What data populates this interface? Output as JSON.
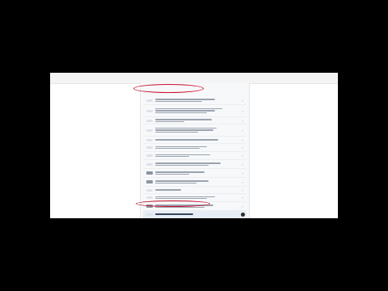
{
  "sidebar": {
    "header": "",
    "items": [
      {
        "icon": "doc-icon",
        "label": "",
        "count": ""
      },
      {
        "icon": "doc-icon",
        "label": "",
        "count": ""
      },
      {
        "icon": "doc-icon",
        "label": "",
        "count": ""
      },
      {
        "icon": "doc-icon",
        "label": "",
        "count": ""
      },
      {
        "icon": "doc-icon",
        "label": "",
        "count": ""
      },
      {
        "icon": "doc-icon",
        "label": "",
        "count": ""
      },
      {
        "icon": "doc-icon",
        "label": "",
        "count": ""
      },
      {
        "icon": "doc-icon",
        "label": "",
        "count": ""
      },
      {
        "icon": "doc-icon",
        "label": "",
        "count": ""
      },
      {
        "icon": "doc-icon",
        "label": "",
        "count": ""
      },
      {
        "icon": "doc-icon",
        "label": "",
        "count": ""
      },
      {
        "icon": "doc-icon",
        "label": "",
        "count": ""
      },
      {
        "icon": "doc-icon",
        "label": "",
        "count": ""
      },
      {
        "icon": "doc-icon",
        "label": "",
        "count": ""
      },
      {
        "icon": "doc-icon",
        "label": "",
        "count": ""
      },
      {
        "icon": "doc-icon",
        "label": "",
        "count": ""
      },
      {
        "icon": "doc-icon",
        "label": "",
        "count": ""
      }
    ]
  },
  "colors": {
    "accent": "#c8102e",
    "header": "#1d4f86",
    "panel": "#f7f8fa"
  }
}
